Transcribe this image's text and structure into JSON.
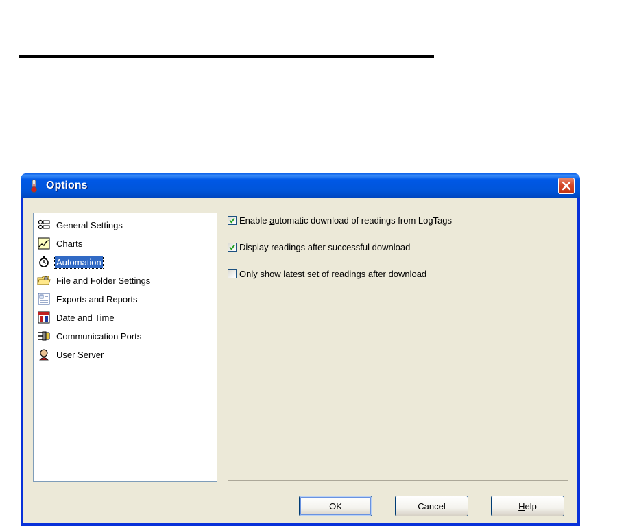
{
  "window": {
    "title": "Options",
    "icon": "thermometer-icon",
    "close_icon": "close-icon"
  },
  "sidebar": {
    "items": [
      {
        "label": "General Settings",
        "icon": "settings-list-icon",
        "selected": false
      },
      {
        "label": "Charts",
        "icon": "chart-icon",
        "selected": false
      },
      {
        "label": "Automation",
        "icon": "stopwatch-icon",
        "selected": true
      },
      {
        "label": "File and Folder Settings",
        "icon": "folder-icon",
        "selected": false
      },
      {
        "label": "Exports and Reports",
        "icon": "report-icon",
        "selected": false
      },
      {
        "label": "Date and Time",
        "icon": "calendar-icon",
        "selected": false
      },
      {
        "label": "Communication Ports",
        "icon": "port-icon",
        "selected": false
      },
      {
        "label": "User Server",
        "icon": "user-server-icon",
        "selected": false
      }
    ]
  },
  "options": [
    {
      "label_before": "Enable ",
      "mnemonic": "a",
      "label_after": "utomatic download of readings from LogTags",
      "checked": true
    },
    {
      "label_before": "Display readings after successful download",
      "mnemonic": "",
      "label_after": "",
      "checked": true
    },
    {
      "label_before": "Only show latest set of readings after download",
      "mnemonic": "",
      "label_after": "",
      "checked": false
    }
  ],
  "buttons": {
    "ok": "OK",
    "cancel": "Cancel",
    "help_mnemonic": "H",
    "help_rest": "elp"
  },
  "colors": {
    "titlebar": "#0055d9",
    "selection": "#316ac5",
    "face": "#ece9d8",
    "close": "#d4492a"
  }
}
